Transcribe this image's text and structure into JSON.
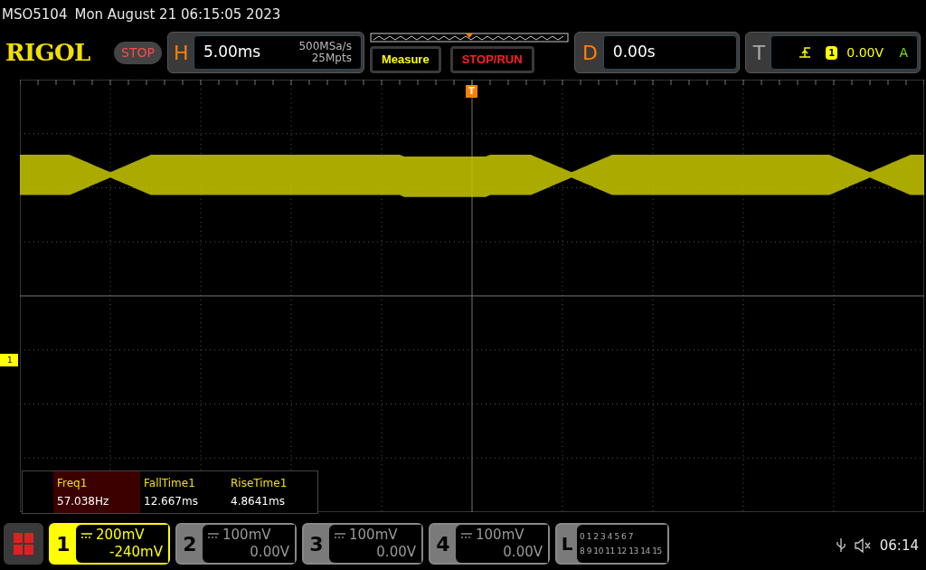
{
  "title_line": {
    "model": "MSO5104",
    "datetime": "Mon August 21 06:15:05 2023"
  },
  "logo": "RIGOL",
  "run_status": "STOP",
  "horizontal": {
    "label": "H",
    "timebase": "5.00ms",
    "sample_rate": "500MSa/s",
    "memory_depth": "25Mpts"
  },
  "buttons": [
    {
      "label": "Measure",
      "kind": "measure"
    },
    {
      "label": "STOP/RUN",
      "kind": "stoprun"
    }
  ],
  "delay": {
    "label": "D",
    "value": "0.00s"
  },
  "trigger": {
    "label": "T",
    "source": "1",
    "level": "0.00V",
    "mode": "A"
  },
  "trigger_marker": "T",
  "channel_marker": "1",
  "measurements": [
    {
      "name": "Freq1",
      "value": "57.038Hz",
      "selected": true
    },
    {
      "name": "FallTime1",
      "value": "12.667ms",
      "selected": false
    },
    {
      "name": "RiseTime1",
      "value": "4.8641ms",
      "selected": false
    }
  ],
  "channels": [
    {
      "number": "1",
      "scale": "200mV",
      "offset": "-240mV",
      "selected": true
    },
    {
      "number": "2",
      "scale": "100mV",
      "offset": "0.00V",
      "selected": false
    },
    {
      "number": "3",
      "scale": "100mV",
      "offset": "0.00V",
      "selected": false
    },
    {
      "number": "4",
      "scale": "100mV",
      "offset": "0.00V",
      "selected": false
    }
  ],
  "logic": {
    "label": "L",
    "bits_row_1": [
      "0",
      "1",
      "2",
      "3",
      "4",
      "5",
      "6",
      "7"
    ],
    "bits_row_2": [
      "8",
      "9",
      "10",
      "11",
      "12",
      "13",
      "14",
      "15"
    ]
  },
  "clock": "06:14"
}
